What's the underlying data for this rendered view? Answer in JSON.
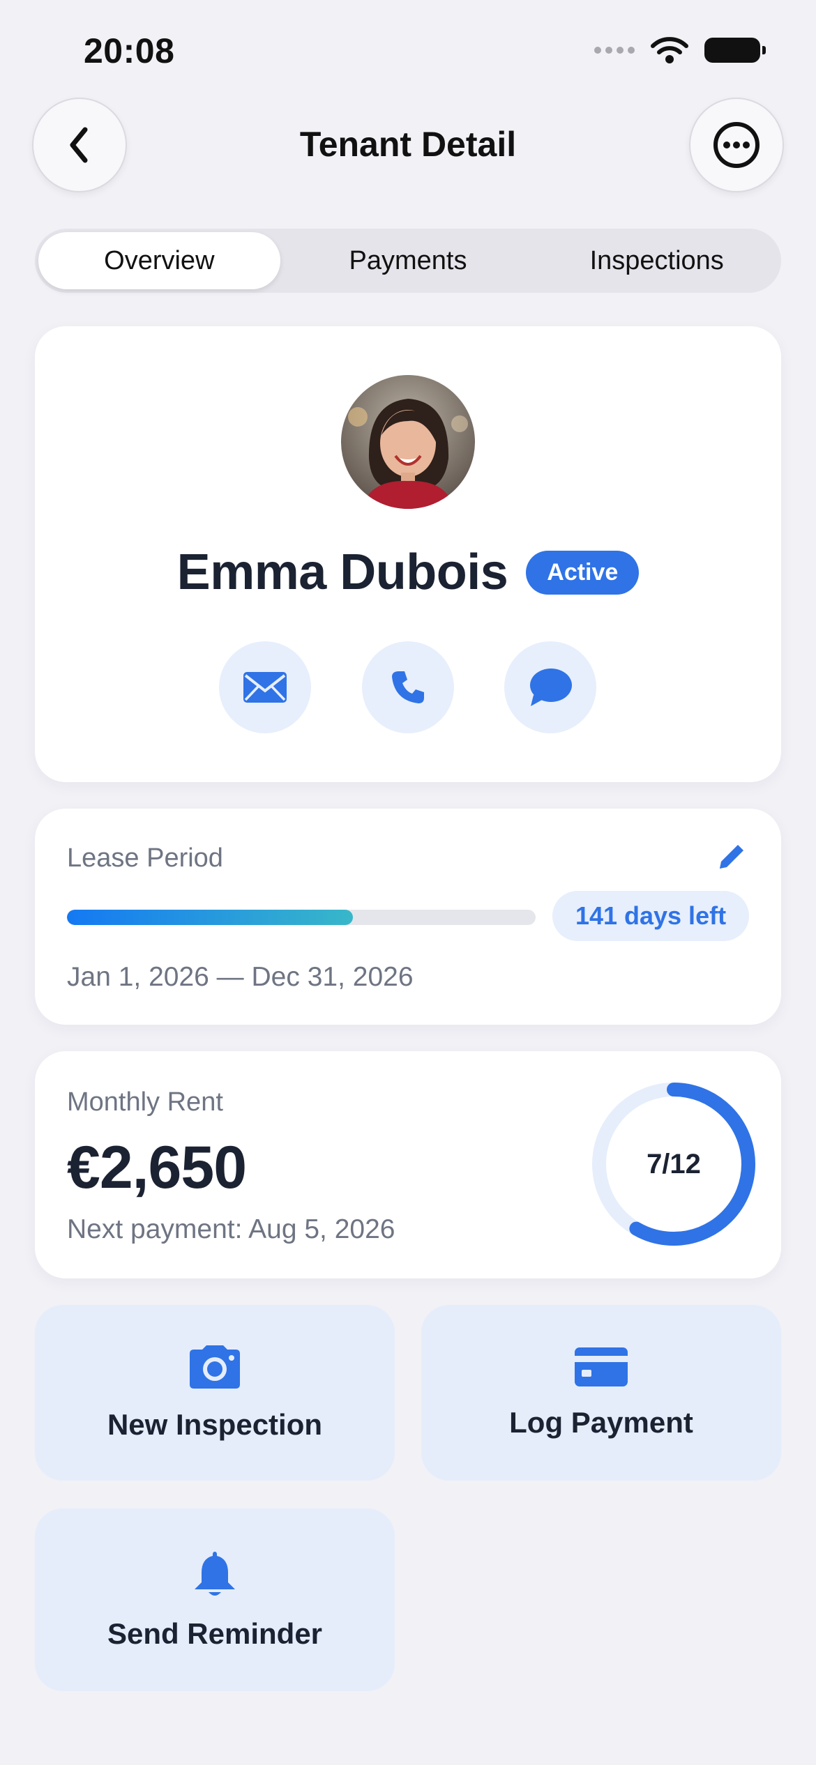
{
  "status_bar": {
    "time": "20:08"
  },
  "nav": {
    "title": "Tenant Detail",
    "back_icon": "chevron-left-icon",
    "more_icon": "ellipsis-circle-icon"
  },
  "tabs": [
    {
      "label": "Overview",
      "active": true
    },
    {
      "label": "Payments",
      "active": false
    },
    {
      "label": "Inspections",
      "active": false
    }
  ],
  "tenant": {
    "name": "Emma Dubois",
    "status": "Active",
    "contact_actions": [
      "envelope-icon",
      "phone-icon",
      "chat-bubble-icon"
    ]
  },
  "lease": {
    "label": "Lease Period",
    "progress": 0.61,
    "days_left": "141 days left",
    "dates": "Jan 1, 2026 — Dec 31, 2026",
    "edit_icon": "pencil-icon"
  },
  "rent": {
    "label": "Monthly Rent",
    "amount": "€2,650",
    "next_payment": "Next payment: Aug 5, 2026",
    "paid_months": 7,
    "total_months": 12,
    "progress_text": "7/12"
  },
  "actions": [
    {
      "label": "New Inspection",
      "icon": "camera-icon"
    },
    {
      "label": "Log Payment",
      "icon": "credit-card-icon"
    },
    {
      "label": "Send Reminder",
      "icon": "bell-icon"
    }
  ],
  "colors": {
    "accent": "#2F73E6",
    "background": "#F1F1F6",
    "tile": "#E5EDFB",
    "progress_start": "#1479F3",
    "progress_end": "#38B7C9"
  }
}
